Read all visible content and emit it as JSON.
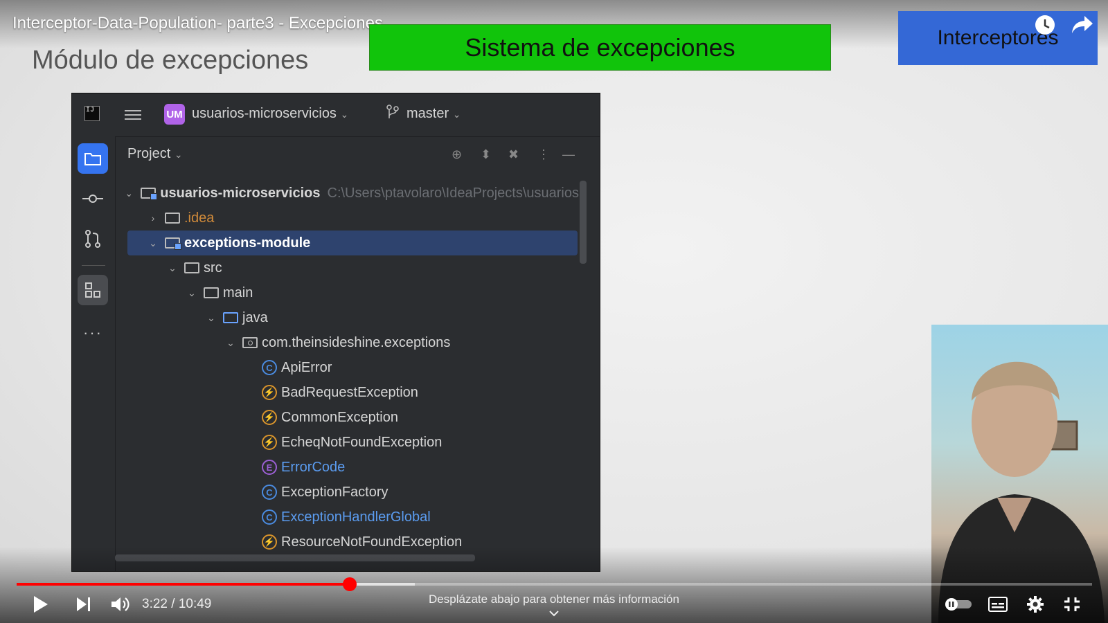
{
  "video": {
    "title": "Interceptor-Data-Population- parte3 - Excepciones",
    "current_time": "3:22",
    "duration": "10:49",
    "time_display": "3:22 / 10:49",
    "played_fraction": 0.31,
    "buffered_fraction": 0.37,
    "scroll_hint": "Desplázate abajo para obtener más información"
  },
  "slide": {
    "heading": "Módulo de excepciones",
    "green_banner": "Sistema de excepciones",
    "blue_banner": "Interceptores",
    "colors": {
      "green_banner": "#11c40b",
      "blue_banner": "#3468d6"
    }
  },
  "ide": {
    "logo": "IJ",
    "project_badge": "UM",
    "project_name": "usuarios-microservicios",
    "branch": "master",
    "panel_title": "Project",
    "sidebar_icons": [
      "folder-icon",
      "commit-icon",
      "pull-requests-icon",
      "structure-icon",
      "more-icon"
    ],
    "tree": [
      {
        "label": "usuarios-microservicios",
        "hint": "C:\\Users\\ptavolaro\\IdeaProjects\\usuarios",
        "kind": "module"
      },
      {
        "label": ".idea",
        "kind": "folder"
      },
      {
        "label": "exceptions-module",
        "kind": "module",
        "selected": true
      },
      {
        "label": "src",
        "kind": "folder"
      },
      {
        "label": "main",
        "kind": "folder"
      },
      {
        "label": "java",
        "kind": "source-folder"
      },
      {
        "label": "com.theinsideshine.exceptions",
        "kind": "package"
      },
      {
        "label": "ApiError",
        "kind": "class"
      },
      {
        "label": "BadRequestException",
        "kind": "exception"
      },
      {
        "label": "CommonException",
        "kind": "exception"
      },
      {
        "label": "EcheqNotFoundException",
        "kind": "exception"
      },
      {
        "label": "ErrorCode",
        "kind": "enum"
      },
      {
        "label": "ExceptionFactory",
        "kind": "class"
      },
      {
        "label": "ExceptionHandlerGlobal",
        "kind": "class"
      },
      {
        "label": "ResourceNotFoundException",
        "kind": "exception"
      }
    ]
  },
  "controls": {
    "icons": [
      "play-icon",
      "next-icon",
      "volume-icon",
      "autoplay-toggle-icon",
      "subtitles-icon",
      "settings-icon",
      "exit-fullscreen-icon"
    ],
    "top_icons": [
      "watch-later-icon",
      "share-icon"
    ]
  }
}
